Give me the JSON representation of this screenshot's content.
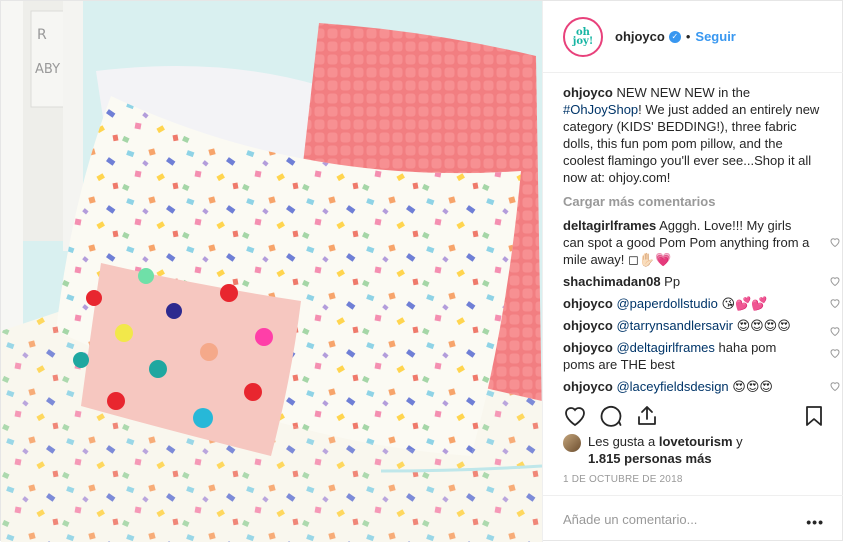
{
  "post": {
    "username": "ohjoyco",
    "avatar_text": "oh joy!",
    "follow_label": "Seguir",
    "separator": "•",
    "verified_symbol": "✓",
    "caption": {
      "user": "ohjoyco",
      "text_before": " NEW NEW NEW in the ",
      "hashtag": "#OhJoyShop",
      "text_after": "! We just added an entirely new category (KIDS' BEDDING!), three fabric dolls, this fun pom pom pillow, and the coolest flamingo you'll ever see...Shop it all now at: ohjoy.com!"
    },
    "load_more_label": "Cargar más comentarios",
    "comments": [
      {
        "user": "deltagirlframes",
        "mention": "",
        "text": " Agggh. Love!!! My girls can spot a good Pom Pom anything from a mile away! ◻✋🏻💗"
      },
      {
        "user": "shachimadan08",
        "mention": "",
        "text": " Pp"
      },
      {
        "user": "ohjoyco",
        "mention": " @paperdollstudio",
        "text": " 😘💕💕"
      },
      {
        "user": "ohjoyco",
        "mention": " @tarrynsandlersavir",
        "text": " 😍😍😍😍"
      },
      {
        "user": "ohjoyco",
        "mention": " @deltagirlframes",
        "text": " haha pom poms are THE best"
      },
      {
        "user": "ohjoyco",
        "mention": " @laceyfieldsdesign",
        "text": " 😍😍😍"
      }
    ],
    "likes": {
      "prefix": "Les gusta a ",
      "user": "lovetourism",
      "middle": " y",
      "count": "1.815 personas más"
    },
    "date": "1 DE OCTUBRE DE 2018",
    "add_comment_placeholder": "Añade un comentario...",
    "more_label": "•••",
    "colors": {
      "accent_blue": "#3897f0",
      "mention_blue": "#003569",
      "muted": "#999999",
      "brand_teal": "#16b5a3",
      "ring_pink": "#e8417b"
    }
  }
}
